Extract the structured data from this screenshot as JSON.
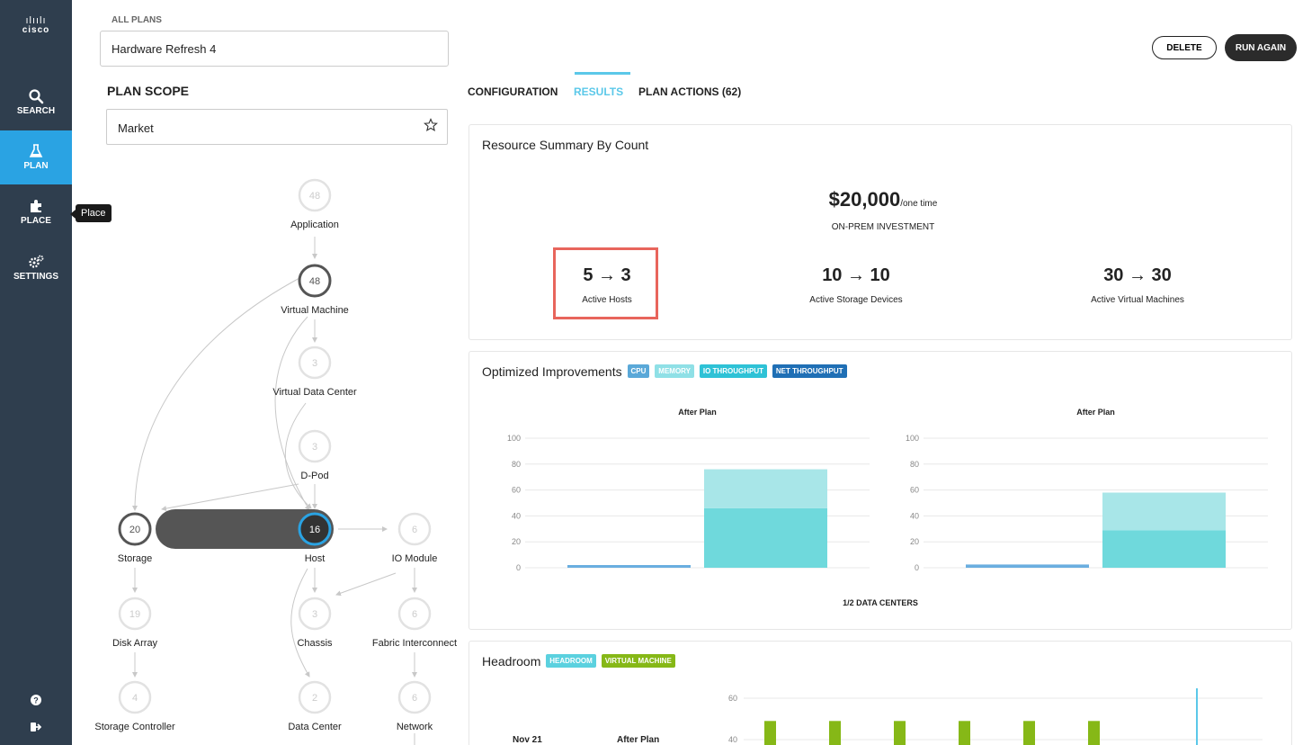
{
  "sidebar": {
    "logo_bars": "ılıılı",
    "logo_text": "cisco",
    "items": [
      {
        "label": "SEARCH",
        "icon": "search-icon"
      },
      {
        "label": "PLAN",
        "icon": "flask-icon"
      },
      {
        "label": "PLACE",
        "icon": "puzzle-icon"
      },
      {
        "label": "SETTINGS",
        "icon": "gears-icon"
      }
    ],
    "tooltip": "Place",
    "active_item": "PLAN",
    "active_color": "#2aa3e3"
  },
  "header": {
    "breadcrumb": "ALL PLANS",
    "plan_name": "Hardware Refresh 4",
    "delete_label": "DELETE",
    "run_again_label": "RUN AGAIN"
  },
  "scope": {
    "title": "PLAN SCOPE",
    "value": "Market"
  },
  "graph": {
    "nodes": [
      {
        "id": "application",
        "label": "Application",
        "count": "48",
        "state": "faded"
      },
      {
        "id": "virtual-machine",
        "label": "Virtual Machine",
        "count": "48",
        "state": "normal"
      },
      {
        "id": "virtual-data-center",
        "label": "Virtual Data Center",
        "count": "3",
        "state": "faded"
      },
      {
        "id": "d-pod",
        "label": "D-Pod",
        "count": "3",
        "state": "faded"
      },
      {
        "id": "storage",
        "label": "Storage",
        "count": "20",
        "state": "normal"
      },
      {
        "id": "host",
        "label": "Host",
        "count": "16",
        "state": "selected"
      },
      {
        "id": "io-module",
        "label": "IO Module",
        "count": "6",
        "state": "faded"
      },
      {
        "id": "disk-array",
        "label": "Disk Array",
        "count": "19",
        "state": "faded"
      },
      {
        "id": "chassis",
        "label": "Chassis",
        "count": "3",
        "state": "faded"
      },
      {
        "id": "fabric-interconnect",
        "label": "Fabric Interconnect",
        "count": "6",
        "state": "faded"
      },
      {
        "id": "storage-controller",
        "label": "Storage Controller",
        "count": "4",
        "state": "faded"
      },
      {
        "id": "data-center",
        "label": "Data Center",
        "count": "2",
        "state": "faded"
      },
      {
        "id": "network",
        "label": "Network",
        "count": "6",
        "state": "faded"
      }
    ]
  },
  "tabs": [
    {
      "label": "CONFIGURATION",
      "active": false
    },
    {
      "label": "RESULTS",
      "active": true
    },
    {
      "label": "PLAN ACTIONS (62)",
      "active": false
    }
  ],
  "summary": {
    "title": "Resource Summary By Count",
    "amount": "$20,000",
    "amount_unit": "/one time",
    "investment_label": "ON-PREM INVESTMENT",
    "metrics": [
      {
        "value": "5 → 3",
        "label": "Active Hosts",
        "highlighted": true
      },
      {
        "value": "10 → 10",
        "label": "Active Storage Devices",
        "highlighted": false
      },
      {
        "value": "30 → 30",
        "label": "Active Virtual Machines",
        "highlighted": false
      }
    ]
  },
  "improvements": {
    "title": "Optimized Improvements",
    "tags": [
      {
        "label": "CPU",
        "color": "#5aa8d8"
      },
      {
        "label": "MEMORY",
        "color": "#8fe0e6"
      },
      {
        "label": "IO THROUGHPUT",
        "color": "#2ec2d6"
      },
      {
        "label": "NET THROUGHPUT",
        "color": "#1f6fb5"
      }
    ],
    "footer": "1/2 DATA CENTERS"
  },
  "headroom": {
    "title": "Headroom",
    "tags": [
      {
        "label": "HEADROOM",
        "color": "#5bd1df"
      },
      {
        "label": "VIRTUAL MACHINE",
        "color": "#86b817"
      }
    ],
    "row_date": "Nov 21",
    "row_label": "After Plan"
  },
  "chart_data": [
    {
      "type": "bar",
      "title": "After Plan",
      "ylim": [
        0,
        100
      ],
      "yticks": [
        "100",
        "80",
        "60",
        "40",
        "20",
        "0"
      ],
      "grid": true,
      "series": [
        {
          "name": "CPU",
          "values": [
            1.5,
            0
          ]
        },
        {
          "name": "IO THROUGHPUT",
          "values": [
            0,
            46
          ]
        },
        {
          "name": "MEMORY",
          "values": [
            0,
            30
          ]
        }
      ]
    },
    {
      "type": "bar",
      "title": "After Plan",
      "ylim": [
        0,
        100
      ],
      "yticks": [
        "100",
        "80",
        "60",
        "40",
        "20",
        "0"
      ],
      "grid": true,
      "series": [
        {
          "name": "CPU",
          "values": [
            2.5,
            0
          ]
        },
        {
          "name": "IO THROUGHPUT",
          "values": [
            0,
            29
          ]
        },
        {
          "name": "MEMORY",
          "values": [
            0,
            29
          ]
        }
      ]
    },
    {
      "type": "bar",
      "title": "",
      "ylim": [
        40,
        60
      ],
      "yticks": [
        "60",
        "40"
      ],
      "grid": true,
      "series": [
        {
          "name": "VIRTUAL MACHINE",
          "values": [
            49,
            49,
            49,
            49,
            49,
            49
          ]
        }
      ]
    }
  ]
}
